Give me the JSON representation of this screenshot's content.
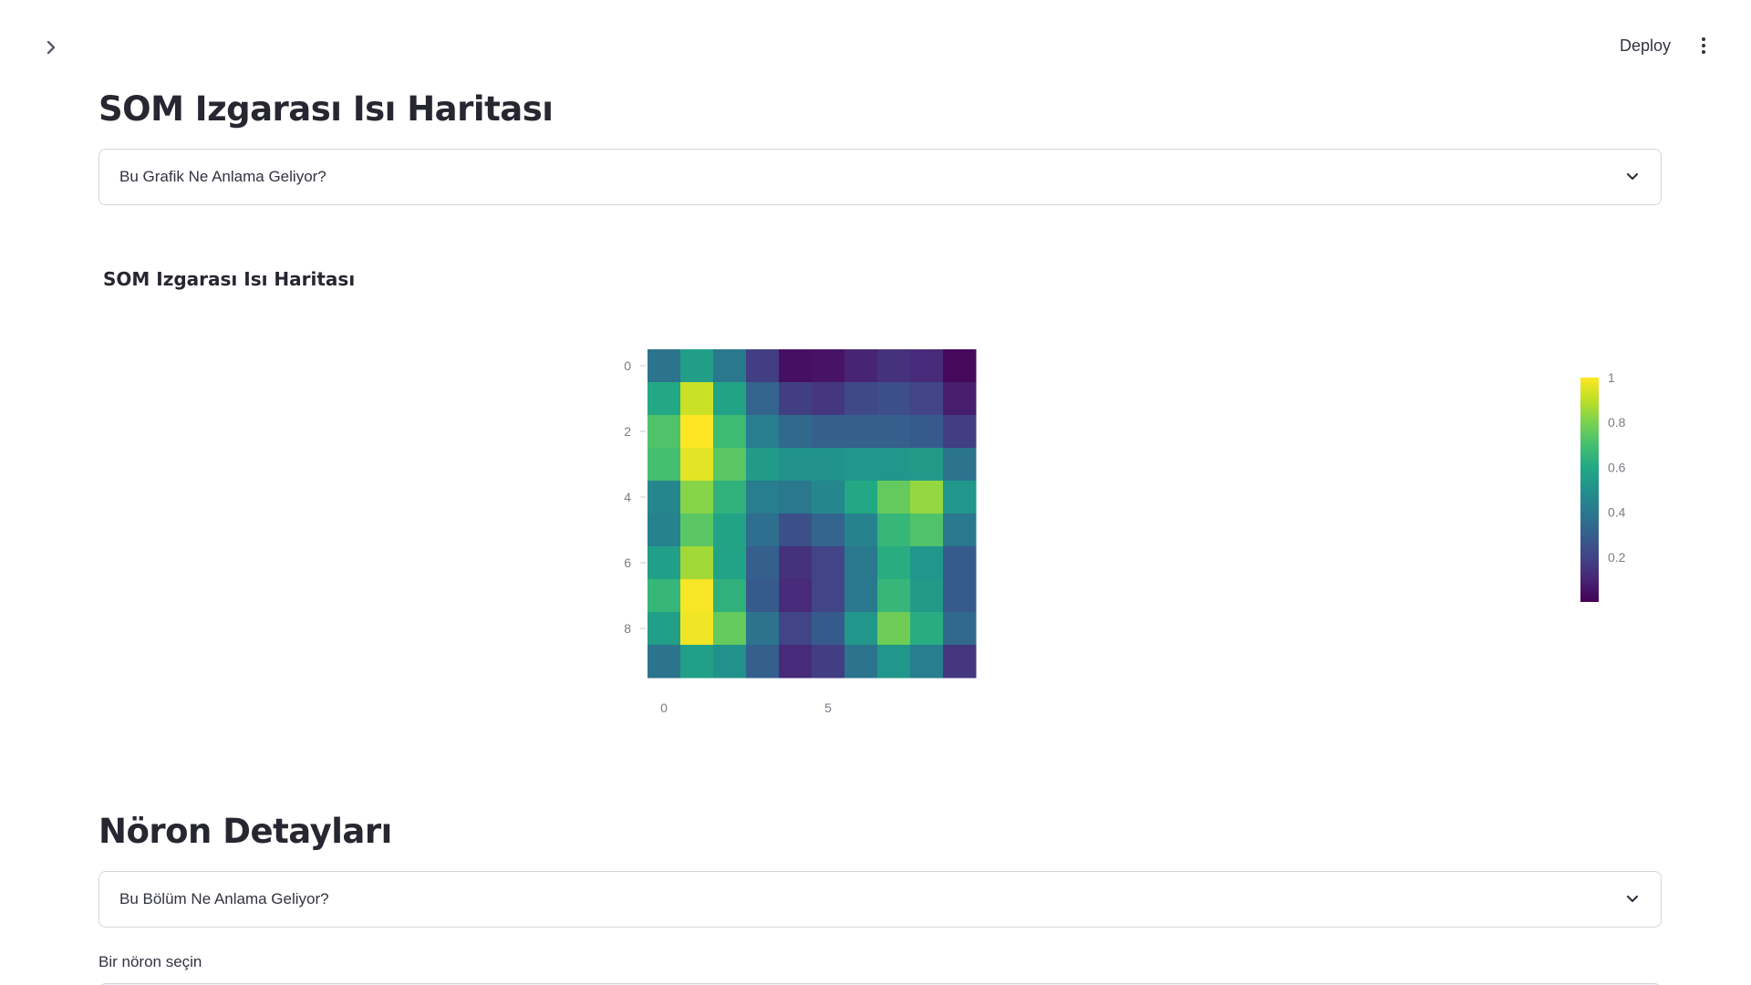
{
  "header": {
    "deploy_label": "Deploy"
  },
  "sections": {
    "som": {
      "title": "SOM Izgarası Isı Haritası",
      "expander_label": "Bu Grafik Ne Anlama Geliyor?"
    },
    "neuron": {
      "title": "Nöron Detayları",
      "expander_label": "Bu Bölüm Ne Anlama Geliyor?",
      "select_label": "Bir nöron seçin"
    }
  },
  "chart_data": {
    "type": "heatmap",
    "title": "SOM Izgarası Isı Haritası",
    "colorscale": "viridis",
    "zlim": [
      0,
      1
    ],
    "x_ticks": [
      0,
      5
    ],
    "y_ticks": [
      0,
      2,
      4,
      6,
      8
    ],
    "colorbar_ticks": [
      "1",
      "0.8",
      "0.6",
      "0.4",
      "0.2"
    ],
    "z": [
      [
        0.38,
        0.55,
        0.4,
        0.18,
        0.04,
        0.05,
        0.1,
        0.14,
        0.12,
        0.02
      ],
      [
        0.6,
        0.92,
        0.58,
        0.32,
        0.18,
        0.16,
        0.22,
        0.24,
        0.2,
        0.08
      ],
      [
        0.72,
        1.0,
        0.68,
        0.42,
        0.34,
        0.3,
        0.3,
        0.3,
        0.28,
        0.18
      ],
      [
        0.7,
        0.96,
        0.74,
        0.54,
        0.5,
        0.5,
        0.52,
        0.52,
        0.54,
        0.38
      ],
      [
        0.46,
        0.82,
        0.64,
        0.42,
        0.4,
        0.46,
        0.6,
        0.76,
        0.84,
        0.52
      ],
      [
        0.44,
        0.74,
        0.58,
        0.36,
        0.24,
        0.32,
        0.44,
        0.66,
        0.72,
        0.4
      ],
      [
        0.56,
        0.86,
        0.58,
        0.3,
        0.14,
        0.2,
        0.4,
        0.62,
        0.52,
        0.28
      ],
      [
        0.66,
        0.99,
        0.64,
        0.28,
        0.12,
        0.2,
        0.4,
        0.66,
        0.54,
        0.28
      ],
      [
        0.56,
        0.98,
        0.76,
        0.38,
        0.2,
        0.28,
        0.52,
        0.78,
        0.62,
        0.34
      ],
      [
        0.38,
        0.56,
        0.5,
        0.3,
        0.12,
        0.18,
        0.38,
        0.52,
        0.42,
        0.16
      ]
    ]
  }
}
